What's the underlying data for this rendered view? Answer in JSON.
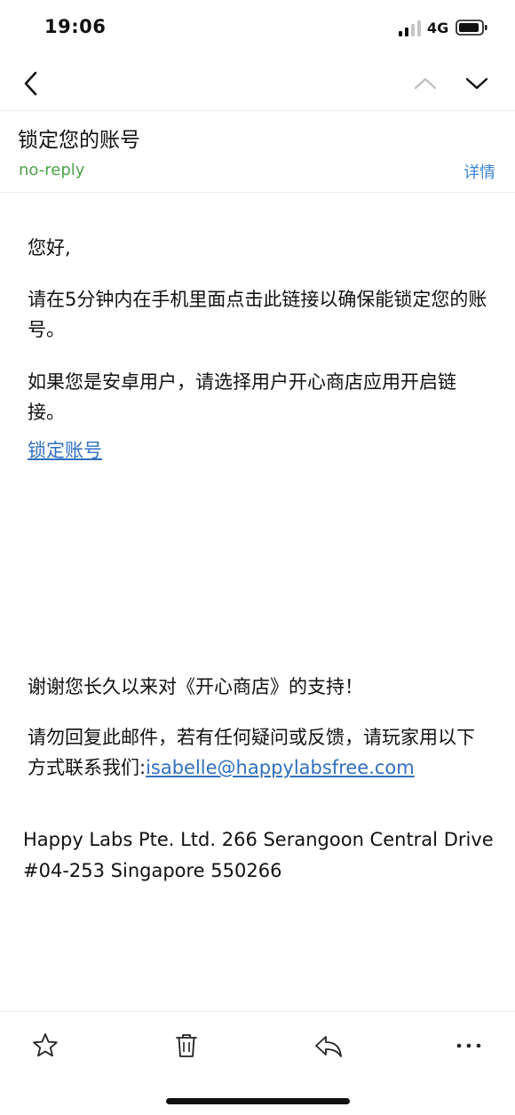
{
  "status_bar": {
    "time": "19:06",
    "network": "4G"
  },
  "nav": {
    "back_icon": "chevron-left-icon",
    "prev_icon": "chevron-up-icon",
    "next_icon": "chevron-down-icon"
  },
  "email": {
    "subject": "锁定您的账号",
    "sender": "no-reply",
    "details_label": "详情",
    "greeting": "您好,",
    "paragraph1": "请在5分钟内在手机里面点击此链接以确保能锁定您的账号。",
    "paragraph2": "如果您是安卓用户，请选择用户开心商店应用开启链接。",
    "lock_link": "锁定账号",
    "thanks": "谢谢您长久以来对《开心商店》的支持！",
    "contact_text": "请勿回复此邮件，若有任何疑问或反馈，请玩家用以下方式联系我们:",
    "contact_email": "isabelle@happylabsfree.com",
    "address": "Happy Labs Pte. Ltd. 266 Serangoon Central Drive #04-253 Singapore 550266"
  },
  "toolbar": {
    "icons": [
      "star-icon",
      "trash-icon",
      "reply-icon",
      "more-icon"
    ]
  },
  "colors": {
    "sender": "#4ca34b",
    "link": "#2f6fbf",
    "details": "#3c86d6"
  }
}
